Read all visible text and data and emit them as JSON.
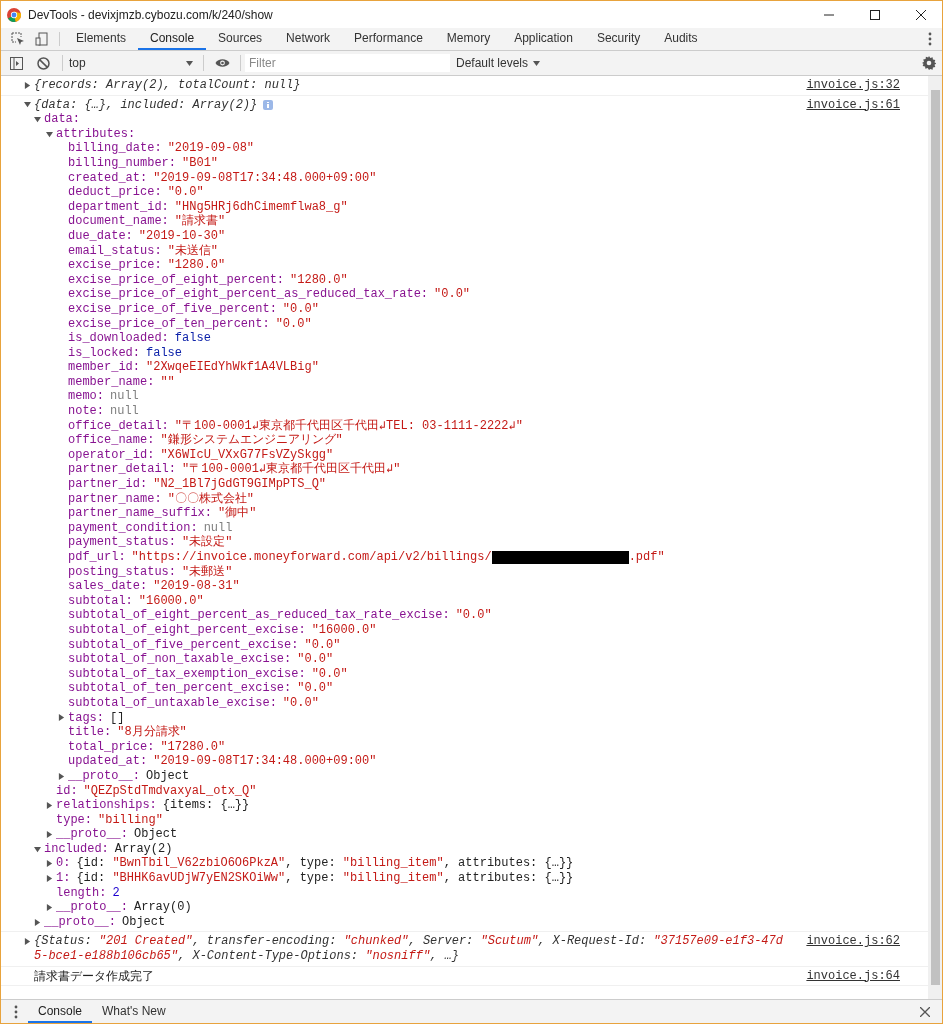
{
  "window": {
    "title": "DevTools - devixjmzb.cybozu.com/k/240/show"
  },
  "tabs": [
    {
      "label": "Elements",
      "selected": false
    },
    {
      "label": "Console",
      "selected": true
    },
    {
      "label": "Sources",
      "selected": false
    },
    {
      "label": "Network",
      "selected": false
    },
    {
      "label": "Performance",
      "selected": false
    },
    {
      "label": "Memory",
      "selected": false
    },
    {
      "label": "Application",
      "selected": false
    },
    {
      "label": "Security",
      "selected": false
    },
    {
      "label": "Audits",
      "selected": false
    }
  ],
  "console_toolbar": {
    "context": "top",
    "filter_placeholder": "Filter",
    "levels": "Default levels"
  },
  "messages": [
    {
      "kind": "object",
      "preview": "{records: Array(2), totalCount: null}",
      "source": "invoice.js:32",
      "expanded": false
    },
    {
      "kind": "object",
      "preview": "{data: {…}, included: Array(2)}",
      "source": "invoice.js:61",
      "info_badge": true,
      "expanded": true,
      "children": [
        {
          "key": "data:",
          "expanded": true,
          "children": [
            {
              "key": "attributes:",
              "expanded": true,
              "children": [
                {
                  "key": "billing_date:",
                  "kind": "string",
                  "value": "\"2019-09-08\""
                },
                {
                  "key": "billing_number:",
                  "kind": "string",
                  "value": "\"B01\""
                },
                {
                  "key": "created_at:",
                  "kind": "string",
                  "value": "\"2019-09-08T17:34:48.000+09:00\""
                },
                {
                  "key": "deduct_price:",
                  "kind": "string",
                  "value": "\"0.0\""
                },
                {
                  "key": "department_id:",
                  "kind": "string",
                  "value": "\"HNg5HRj6dhCimemflwa8_g\""
                },
                {
                  "key": "document_name:",
                  "kind": "string",
                  "value": "\"請求書\""
                },
                {
                  "key": "due_date:",
                  "kind": "string",
                  "value": "\"2019-10-30\""
                },
                {
                  "key": "email_status:",
                  "kind": "string",
                  "value": "\"未送信\""
                },
                {
                  "key": "excise_price:",
                  "kind": "string",
                  "value": "\"1280.0\""
                },
                {
                  "key": "excise_price_of_eight_percent:",
                  "kind": "string",
                  "value": "\"1280.0\""
                },
                {
                  "key": "excise_price_of_eight_percent_as_reduced_tax_rate:",
                  "kind": "string",
                  "value": "\"0.0\""
                },
                {
                  "key": "excise_price_of_five_percent:",
                  "kind": "string",
                  "value": "\"0.0\""
                },
                {
                  "key": "excise_price_of_ten_percent:",
                  "kind": "string",
                  "value": "\"0.0\""
                },
                {
                  "key": "is_downloaded:",
                  "kind": "boolean",
                  "value": "false"
                },
                {
                  "key": "is_locked:",
                  "kind": "boolean",
                  "value": "false"
                },
                {
                  "key": "member_id:",
                  "kind": "string",
                  "value": "\"2XwqeEIEdYhWkf1A4VLBig\""
                },
                {
                  "key": "member_name:",
                  "kind": "string",
                  "value": "\"\""
                },
                {
                  "key": "memo:",
                  "kind": "null",
                  "value": "null"
                },
                {
                  "key": "note:",
                  "kind": "null",
                  "value": "null"
                },
                {
                  "key": "office_detail:",
                  "kind": "string",
                  "value": "\"〒100-0001↲東京都千代田区千代田↲TEL: 03-1111-2222↲\""
                },
                {
                  "key": "office_name:",
                  "kind": "string",
                  "value": "\"鎌形システムエンジニアリング\""
                },
                {
                  "key": "operator_id:",
                  "kind": "string",
                  "value": "\"X6WIcU_VXxG77FsVZySkgg\""
                },
                {
                  "key": "partner_detail:",
                  "kind": "string",
                  "value": "\"〒100-0001↲東京都千代田区千代田↲\""
                },
                {
                  "key": "partner_id:",
                  "kind": "string",
                  "value": "\"N2_1Bl7jGdGT9GIMpPTS_Q\""
                },
                {
                  "key": "partner_name:",
                  "kind": "string",
                  "value": "\"〇〇株式会社\""
                },
                {
                  "key": "partner_name_suffix:",
                  "kind": "string",
                  "value": "\"御中\""
                },
                {
                  "key": "payment_condition:",
                  "kind": "null",
                  "value": "null"
                },
                {
                  "key": "payment_status:",
                  "kind": "string",
                  "value": "\"未設定\""
                },
                {
                  "key": "pdf_url:",
                  "kind": "string",
                  "value": "\"https://invoice.moneyforward.com/api/v2/billings/",
                  "redacted": true,
                  "value_end": ".pdf\""
                },
                {
                  "key": "posting_status:",
                  "kind": "string",
                  "value": "\"未郵送\""
                },
                {
                  "key": "sales_date:",
                  "kind": "string",
                  "value": "\"2019-08-31\""
                },
                {
                  "key": "subtotal:",
                  "kind": "string",
                  "value": "\"16000.0\""
                },
                {
                  "key": "subtotal_of_eight_percent_as_reduced_tax_rate_excise:",
                  "kind": "string",
                  "value": "\"0.0\""
                },
                {
                  "key": "subtotal_of_eight_percent_excise:",
                  "kind": "string",
                  "value": "\"16000.0\""
                },
                {
                  "key": "subtotal_of_five_percent_excise:",
                  "kind": "string",
                  "value": "\"0.0\""
                },
                {
                  "key": "subtotal_of_non_taxable_excise:",
                  "kind": "string",
                  "value": "\"0.0\""
                },
                {
                  "key": "subtotal_of_tax_exemption_excise:",
                  "kind": "string",
                  "value": "\"0.0\""
                },
                {
                  "key": "subtotal_of_ten_percent_excise:",
                  "kind": "string",
                  "value": "\"0.0\""
                },
                {
                  "key": "subtotal_of_untaxable_excise:",
                  "kind": "string",
                  "value": "\"0.0\""
                },
                {
                  "key": "tags:",
                  "kind": "object",
                  "value": "[]",
                  "expanded": false
                },
                {
                  "key": "title:",
                  "kind": "string",
                  "value": "\"8月分請求\""
                },
                {
                  "key": "total_price:",
                  "kind": "string",
                  "value": "\"17280.0\""
                },
                {
                  "key": "updated_at:",
                  "kind": "string",
                  "value": "\"2019-09-08T17:34:48.000+09:00\""
                },
                {
                  "key": "__proto__:",
                  "kind": "object",
                  "value": "Object",
                  "expanded": false
                }
              ]
            },
            {
              "key": "id:",
              "kind": "string",
              "value": "\"QEZpStdTmdvaxyaL_otx_Q\""
            },
            {
              "key": "relationships:",
              "kind": "object",
              "value": "{items: {…}}",
              "expanded": false
            },
            {
              "key": "type:",
              "kind": "string",
              "value": "\"billing\""
            },
            {
              "key": "__proto__:",
              "kind": "object",
              "value": "Object",
              "expanded": false
            }
          ]
        },
        {
          "key": "included:",
          "kind": "object",
          "value": "Array(2)",
          "expanded": true,
          "children": [
            {
              "key": "0:",
              "kind": "object",
              "value": "{id: \"BwnTbil_V62zbiO6O6PkzA\", type: \"billing_item\", attributes: {…}}",
              "expanded": false
            },
            {
              "key": "1:",
              "kind": "object",
              "value": "{id: \"BHHK6avUDjW7yEN2SKOiWw\", type: \"billing_item\", attributes: {…}}",
              "expanded": false
            },
            {
              "key": "length:",
              "kind": "number",
              "value": "2"
            },
            {
              "key": "__proto__:",
              "kind": "object",
              "value": "Array(0)",
              "expanded": false
            }
          ]
        },
        {
          "key": "__proto__:",
          "kind": "object",
          "value": "Object",
          "expanded": false
        }
      ]
    },
    {
      "kind": "object",
      "preview": "{Status: \"201 Created\", transfer-encoding: \"chunked\", Server: \"Scutum\", X-Request-Id: \"37157e09-e1f3-47d5-bce1-e188b106cb65\", X-Content-Type-Options: \"nosniff\", …}",
      "source": "invoice.js:62",
      "expanded": false
    },
    {
      "kind": "log",
      "preview": "請求書データ作成完了",
      "source": "invoice.js:64"
    }
  ],
  "drawer": {
    "tabs": [
      {
        "label": "Console",
        "selected": true
      },
      {
        "label": "What's New",
        "selected": false
      }
    ]
  }
}
